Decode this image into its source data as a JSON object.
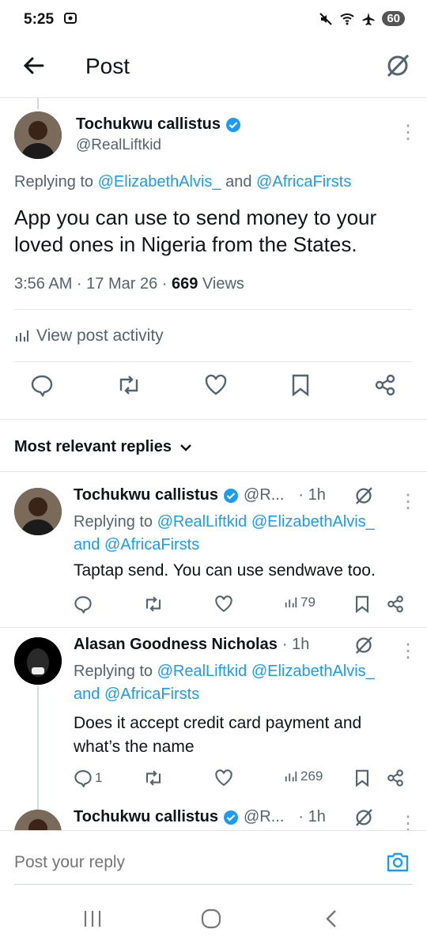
{
  "status_bar": {
    "time": "5:25",
    "battery": "60"
  },
  "header": {
    "title": "Post"
  },
  "main_post": {
    "author_name": "Tochukwu callistus",
    "author_handle": "@RealLiftkid",
    "replying_prefix": "Replying to ",
    "replying_user1": "@ElizabethAlvis_",
    "replying_and": " and ",
    "replying_user2": "@AfricaFirsts",
    "text": "App you can use to send money to your loved ones in Nigeria from the States.",
    "time": "3:56 AM · 17 Mar 26 · ",
    "views_count": "669",
    "views_label": " Views",
    "activity_label": "View post activity"
  },
  "replies_section": {
    "sort_label": "Most relevant replies"
  },
  "replies": [
    {
      "author_name": "Tochukwu callistus",
      "handle_trunc": "@R...",
      "time": "· 1h",
      "replying_prefix": "Replying to ",
      "replying_user1": "@RealLiftkid",
      "replying_user2": "@ElizabethAlvis_",
      "replying_and": "and ",
      "replying_user3": "@AfricaFirsts",
      "text": "Taptap send. You can use sendwave too.",
      "reply_count": "",
      "views": "79"
    },
    {
      "author_name": "Alasan Goodness Nicholas",
      "time": "· 1h",
      "replying_prefix": "Replying to ",
      "replying_user1": "@RealLiftkid",
      "replying_user2": "@ElizabethAlvis_",
      "replying_and": "and ",
      "replying_user3": "@AfricaFirsts",
      "text": "Does it accept credit card payment and what’s the name",
      "reply_count": "1",
      "views": "269"
    },
    {
      "author_name": "Tochukwu callistus",
      "handle_trunc": "@R...",
      "time": "· 1h"
    }
  ],
  "composer": {
    "placeholder": "Post your reply"
  },
  "colors": {
    "accent": "#1d9bf0",
    "secondary": "#536471"
  }
}
